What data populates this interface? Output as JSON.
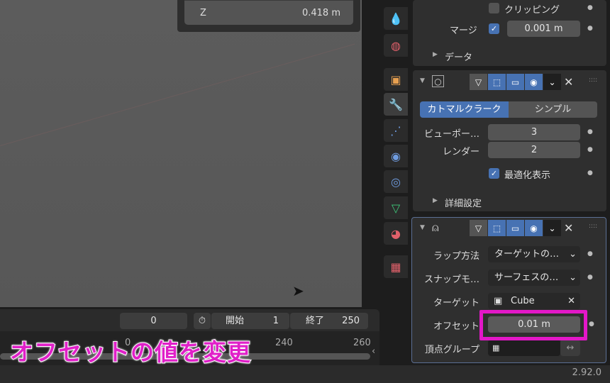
{
  "viewport": {
    "overlay": {
      "z_label": "Z",
      "z_value": "0.418 m"
    }
  },
  "property_tabs": [
    "tool",
    "world",
    "object",
    "modifiers",
    "particles",
    "physics",
    "constraints",
    "data",
    "material",
    "texture"
  ],
  "modifiers": {
    "mirror": {
      "clipping_label": "クリッピング",
      "clipping_checked": false,
      "merge_label": "マージ",
      "merge_checked": true,
      "merge_value": "0.001 m",
      "data_label": "データ"
    },
    "subdivision": {
      "type_options": [
        "カトマルクラーク",
        "シンプル"
      ],
      "selected_type": "カトマルクラーク",
      "viewport_label": "ビューポー…",
      "viewport_value": "3",
      "render_label": "レンダー",
      "render_value": "2",
      "optimal_label": "最適化表示",
      "optimal_checked": true,
      "advanced_label": "詳細設定"
    },
    "shrinkwrap": {
      "wrap_method_label": "ラップ方法",
      "wrap_method_value": "ターゲットの…",
      "snap_mode_label": "スナップモ…",
      "snap_mode_value": "サーフェスの…",
      "target_label": "ターゲット",
      "target_value": "Cube",
      "offset_label": "オフセット",
      "offset_value": "0.01 m",
      "vertex_group_label": "頂点グループ",
      "vertex_group_value": ""
    }
  },
  "timeline": {
    "current_frame": "0",
    "start_label": "開始",
    "start_value": "1",
    "end_label": "終了",
    "end_value": "250",
    "ruler_ticks": [
      "0",
      "240",
      "260"
    ]
  },
  "status": {
    "version": "2.92.0"
  },
  "annotation": {
    "caption": "オフセットの値を変更",
    "highlight_color": "#e317c8"
  }
}
